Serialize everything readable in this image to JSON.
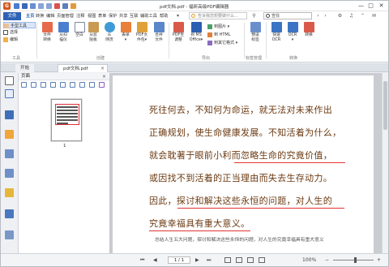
{
  "window": {
    "title": "pdf文档.pdf - 福昕高级PDF编辑器",
    "logo": "G",
    "minimize": "—",
    "maximize": "□",
    "close": "✕"
  },
  "tabs": {
    "file": "文件",
    "items": [
      "主页",
      "转换",
      "编辑",
      "页面管理",
      "注释",
      "视图",
      "表单",
      "保护",
      "共享",
      "互联",
      "辅助工具",
      "帮助"
    ],
    "active_index": 0,
    "tell_me": "告诉我您想要做什么...",
    "find_placeholder": "查找"
  },
  "ribbon": {
    "tools_small": [
      "手型工具",
      "选择",
      "编辑"
    ],
    "group_tools": "工具",
    "buttons": [
      {
        "label": "文件\n转换"
      },
      {
        "label": "从扫\n描仪"
      },
      {
        "label": "空白"
      },
      {
        "label": "从剪\n贴板"
      },
      {
        "label": "从\n网页"
      },
      {
        "label": "表单\n▾"
      },
      {
        "label": "PDF文\n件包▾"
      },
      {
        "label": "合并\n文件"
      },
      {
        "label": "PDF至\n调整"
      },
      {
        "label": "到 MS\nOffice▾"
      },
      {
        "label": "预设\n标签"
      },
      {
        "label": "快速\nOCR"
      },
      {
        "label": "OCR\n▾"
      },
      {
        "label": "转换"
      }
    ],
    "group_create": "创建",
    "export_small": [
      "到图片 ▾",
      "到 HTML",
      "到其它格式 ▾"
    ],
    "group_export": "导出",
    "group_tagged": "标签管理",
    "group_convert": "转换"
  },
  "doc_tabs": {
    "start": "开始",
    "current": "pdf文档.pdf",
    "close": "×"
  },
  "pages_panel": {
    "title": "页面",
    "close": "×",
    "thumb_page_number": "1"
  },
  "document": {
    "lines": [
      "死往何去，不知何为命运，就无法对未来作出",
      "正确规划，使生命健康发展。不知活着为什么，",
      "就会耽著于眼前小利而忽略生命的究竟价值，",
      "或因找不到活着的正当理由而失去生存动力。",
      "因此，探讨和解决这些永恒的问题，对人生的",
      "究竟幸福具有重大意义。"
    ],
    "caption": "总结人生五大问题，探讨和解决这些永恒的问题，对人生的究竟幸福具有重大意义"
  },
  "statusbar": {
    "nav_first": "⏮",
    "nav_prev": "◀",
    "page_value": "1 / 1",
    "nav_next": "▶",
    "nav_last": "⏭",
    "zoom": "100%",
    "zoom_out": "−",
    "zoom_in": "+"
  },
  "colors": {
    "accent": "#2f62b6",
    "logo": "#d4561a",
    "text_brown": "#6b3a12",
    "wavy_red": "#e23333"
  }
}
